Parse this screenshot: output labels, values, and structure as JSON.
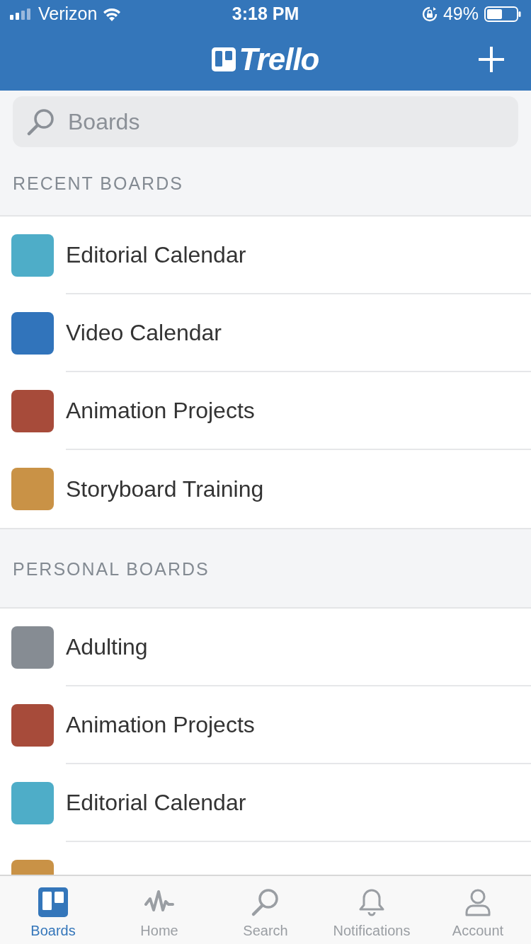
{
  "status_bar": {
    "carrier": "Verizon",
    "time": "3:18 PM",
    "battery": "49%"
  },
  "header": {
    "logo_text": "Trello"
  },
  "search": {
    "placeholder": "Boards"
  },
  "sections": [
    {
      "title": "RECENT BOARDS",
      "boards": [
        {
          "name": "Editorial Calendar",
          "color": "#4eadc8"
        },
        {
          "name": "Video Calendar",
          "color": "#3174bb"
        },
        {
          "name": "Animation Projects",
          "color": "#a74b3a"
        },
        {
          "name": "Storyboard Training",
          "color": "#c99246"
        }
      ]
    },
    {
      "title": "PERSONAL BOARDS",
      "boards": [
        {
          "name": "Adulting",
          "color": "#868c93"
        },
        {
          "name": "Animation Projects",
          "color": "#a74b3a"
        },
        {
          "name": "Editorial Calendar",
          "color": "#4eadc8"
        },
        {
          "color": "#c99246"
        }
      ]
    }
  ],
  "tabs": [
    {
      "kind": "boards",
      "label": "Boards",
      "selected": true
    },
    {
      "kind": "home",
      "label": "Home",
      "selected": false
    },
    {
      "kind": "search",
      "label": "Search",
      "selected": false
    },
    {
      "kind": "notifications",
      "label": "Notifications",
      "selected": false
    },
    {
      "kind": "account",
      "label": "Account",
      "selected": false
    }
  ]
}
